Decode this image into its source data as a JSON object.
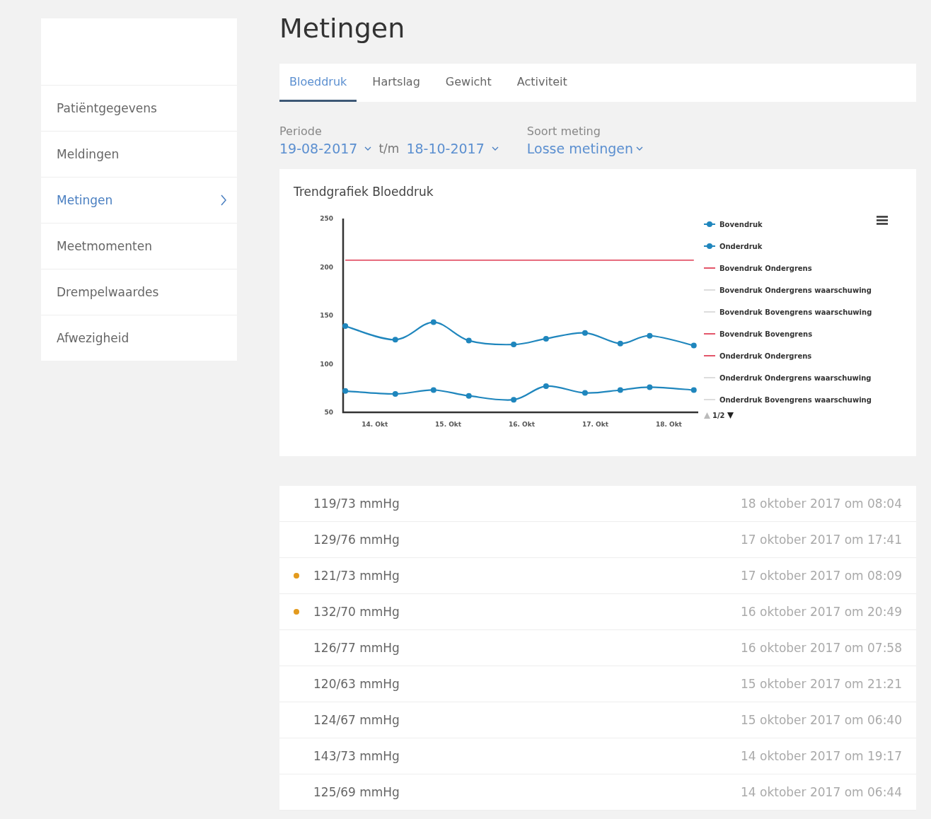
{
  "sidebar": {
    "items": [
      {
        "label": "Patiëntgegevens",
        "selected": false
      },
      {
        "label": "Meldingen",
        "selected": false
      },
      {
        "label": "Metingen",
        "selected": true
      },
      {
        "label": "Meetmomenten",
        "selected": false
      },
      {
        "label": "Drempelwaardes",
        "selected": false
      },
      {
        "label": "Afwezigheid",
        "selected": false
      }
    ]
  },
  "page_title": "Metingen",
  "tabs": [
    {
      "label": "Bloeddruk",
      "selected": true
    },
    {
      "label": "Hartslag",
      "selected": false
    },
    {
      "label": "Gewicht",
      "selected": false
    },
    {
      "label": "Activiteit",
      "selected": false
    }
  ],
  "filters": {
    "period_label": "Periode",
    "from": "19-08-2017",
    "separator": "t/m",
    "to": "18-10-2017",
    "type_label": "Soort meting",
    "type_value": "Losse metingen"
  },
  "chart": {
    "title": "Trendgrafiek Bloeddruk",
    "chart_data": {
      "type": "line",
      "x": [
        13.6,
        14.28,
        14.8,
        15.28,
        15.89,
        16.33,
        16.86,
        17.34,
        17.74,
        18.34
      ],
      "series": [
        {
          "name": "Bovendruk",
          "color": "#1f86bd",
          "marker": true,
          "values": [
            139,
            125,
            143,
            124,
            120,
            126,
            132,
            121,
            129,
            119
          ]
        },
        {
          "name": "Onderdruk",
          "color": "#1f86bd",
          "marker": true,
          "values": [
            72,
            69,
            73,
            67,
            63,
            77,
            70,
            73,
            76,
            73
          ]
        },
        {
          "name": "Bovendruk Ondergrens",
          "color": "#e3566a",
          "values": [
            null,
            null,
            null,
            null,
            null,
            null,
            null,
            null,
            null,
            null
          ]
        },
        {
          "name": "Bovendruk Ondergrens waarschuwing",
          "color": "#dddddd",
          "values": [
            null,
            null,
            null,
            null,
            null,
            null,
            null,
            null,
            null,
            null
          ]
        },
        {
          "name": "Bovendruk Bovengrens waarschuwing",
          "color": "#dddddd",
          "values": [
            null,
            null,
            null,
            null,
            null,
            null,
            null,
            null,
            null,
            null
          ]
        },
        {
          "name": "Bovendruk Bovengrens",
          "color": "#e3566a",
          "values": [
            207,
            207,
            207,
            207,
            207,
            207,
            207,
            207,
            207,
            207
          ]
        },
        {
          "name": "Onderdruk Ondergrens",
          "color": "#e3566a",
          "values": [
            null,
            null,
            null,
            null,
            null,
            null,
            null,
            null,
            null,
            null
          ]
        },
        {
          "name": "Onderdruk Ondergrens waarschuwing",
          "color": "#dddddd",
          "values": [
            null,
            null,
            null,
            null,
            null,
            null,
            null,
            null,
            null,
            null
          ]
        },
        {
          "name": "Onderdruk Bovengrens waarschuwing",
          "color": "#dddddd",
          "values": [
            null,
            null,
            null,
            null,
            null,
            null,
            null,
            null,
            null,
            null
          ]
        }
      ],
      "xlim": [
        13.57,
        18.4
      ],
      "ylim": [
        50,
        250
      ],
      "yticks": [
        50,
        100,
        150,
        200,
        250
      ],
      "xticks": [
        {
          "value": 14,
          "label": "14. Okt"
        },
        {
          "value": 15,
          "label": "15. Okt"
        },
        {
          "value": 16,
          "label": "16. Okt"
        },
        {
          "value": 17,
          "label": "17. Okt"
        },
        {
          "value": 18,
          "label": "18. Okt"
        }
      ]
    },
    "pager": "1/2"
  },
  "measurements": [
    {
      "value": "119/73 mmHg",
      "time": "18 oktober 2017 om 08:04",
      "flagged": false
    },
    {
      "value": "129/76 mmHg",
      "time": "17 oktober 2017 om 17:41",
      "flagged": false
    },
    {
      "value": "121/73 mmHg",
      "time": "17 oktober 2017 om 08:09",
      "flagged": true
    },
    {
      "value": "132/70 mmHg",
      "time": "16 oktober 2017 om 20:49",
      "flagged": true
    },
    {
      "value": "126/77 mmHg",
      "time": "16 oktober 2017 om 07:58",
      "flagged": false
    },
    {
      "value": "120/63 mmHg",
      "time": "15 oktober 2017 om 21:21",
      "flagged": false
    },
    {
      "value": "124/67 mmHg",
      "time": "15 oktober 2017 om 06:40",
      "flagged": false
    },
    {
      "value": "143/73 mmHg",
      "time": "14 oktober 2017 om 19:17",
      "flagged": false
    },
    {
      "value": "125/69 mmHg",
      "time": "14 oktober 2017 om 06:44",
      "flagged": false
    }
  ]
}
